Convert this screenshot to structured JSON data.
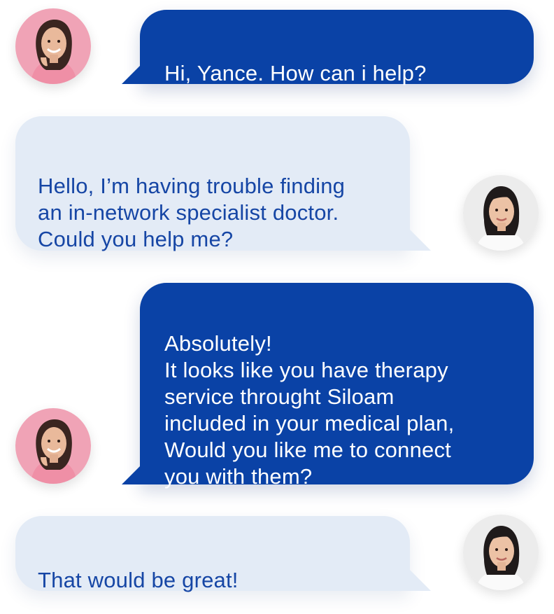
{
  "colors": {
    "agent_bubble": "#0a42a6",
    "agent_text": "#ffffff",
    "user_bubble": "#e3ebf6",
    "user_text": "#1646a5"
  },
  "messages": [
    {
      "sender": "agent",
      "avatar_icon": "agent-avatar-icon",
      "text": "Hi, Yance. How can i help?"
    },
    {
      "sender": "user",
      "avatar_icon": "user-avatar-icon",
      "text": "Hello, I’m having trouble finding\nan in-network specialist doctor.\nCould you help me?"
    },
    {
      "sender": "agent",
      "avatar_icon": "agent-avatar-icon",
      "text": "Absolutely!\nIt looks like you have therapy\nservice throught Siloam\nincluded in your medical plan,\nWould you like me to connect\nyou with them?"
    },
    {
      "sender": "user",
      "avatar_icon": "user-avatar-icon",
      "text": "That would be great!"
    }
  ]
}
